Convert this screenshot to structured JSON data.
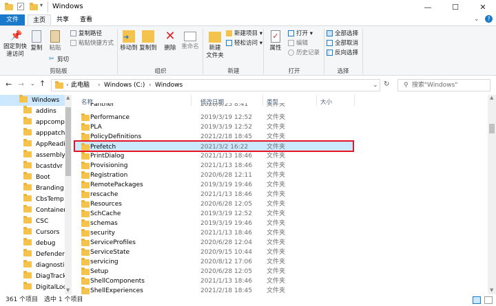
{
  "window": {
    "title": "Windows",
    "minimize": "—",
    "maximize": "☐",
    "close": "✕",
    "help": "?"
  },
  "tabs": [
    {
      "label": "文件"
    },
    {
      "label": "主页"
    },
    {
      "label": "共享"
    },
    {
      "label": "查看"
    }
  ],
  "ribbon": {
    "clipboard": {
      "pin": "固定到快\n速访问",
      "copy": "复制",
      "paste": "粘贴",
      "copy_path": "复制路径",
      "paste_shortcut": "粘贴快捷方式",
      "cut": "剪切",
      "label": "剪贴板"
    },
    "organize": {
      "move_to": "移动到",
      "copy_to": "复制到",
      "delete": "删除",
      "rename": "重命名",
      "label": "组织"
    },
    "new": {
      "new_folder": "新建\n文件夹",
      "new_item": "新建项目",
      "easy_access": "轻松访问",
      "label": "新建"
    },
    "open": {
      "properties": "属性",
      "open": "打开",
      "edit": "编辑",
      "history": "历史记录",
      "label": "打开"
    },
    "select": {
      "select_all": "全部选择",
      "select_none": "全部取消",
      "invert": "反向选择",
      "label": "选择"
    }
  },
  "address": {
    "crumbs": [
      "此电脑",
      "Windows (C:)",
      "Windows"
    ],
    "search_placeholder": "搜索\"Windows\""
  },
  "columns": {
    "name": "名称",
    "date": "修改日期",
    "type": "类型",
    "size": "大小"
  },
  "nav": [
    "Windows",
    "addins",
    "appcompat",
    "apppatch",
    "AppReadine",
    "assembly",
    "bcastdvr",
    "Boot",
    "Branding",
    "CbsTemp",
    "Containers",
    "CSC",
    "Cursors",
    "debug",
    "Defender",
    "diagnostics",
    "DiagTrack",
    "DigitalLocke"
  ],
  "files": [
    {
      "name": "Panther",
      "date": "2020/9/25 8:41",
      "type": "文件夹"
    },
    {
      "name": "Performance",
      "date": "2019/3/19 12:52",
      "type": "文件夹"
    },
    {
      "name": "PLA",
      "date": "2019/3/19 12:52",
      "type": "文件夹"
    },
    {
      "name": "PolicyDefinitions",
      "date": "2021/2/18 18:45",
      "type": "文件夹"
    },
    {
      "name": "Prefetch",
      "date": "2021/3/2 16:22",
      "type": "文件夹"
    },
    {
      "name": "PrintDialog",
      "date": "2021/1/13 18:46",
      "type": "文件夹"
    },
    {
      "name": "Provisioning",
      "date": "2021/1/13 18:46",
      "type": "文件夹"
    },
    {
      "name": "Registration",
      "date": "2020/6/28 12:11",
      "type": "文件夹"
    },
    {
      "name": "RemotePackages",
      "date": "2019/3/19 19:46",
      "type": "文件夹"
    },
    {
      "name": "rescache",
      "date": "2021/1/13 18:46",
      "type": "文件夹"
    },
    {
      "name": "Resources",
      "date": "2020/6/28 12:05",
      "type": "文件夹"
    },
    {
      "name": "SchCache",
      "date": "2019/3/19 12:52",
      "type": "文件夹"
    },
    {
      "name": "schemas",
      "date": "2019/3/19 19:46",
      "type": "文件夹"
    },
    {
      "name": "security",
      "date": "2021/1/13 18:46",
      "type": "文件夹"
    },
    {
      "name": "ServiceProfiles",
      "date": "2020/6/28 12:04",
      "type": "文件夹"
    },
    {
      "name": "ServiceState",
      "date": "2020/9/15 10:44",
      "type": "文件夹"
    },
    {
      "name": "servicing",
      "date": "2020/8/12 17:06",
      "type": "文件夹"
    },
    {
      "name": "Setup",
      "date": "2020/6/28 12:05",
      "type": "文件夹"
    },
    {
      "name": "ShellComponents",
      "date": "2021/1/13 18:46",
      "type": "文件夹"
    },
    {
      "name": "ShellExperiences",
      "date": "2021/2/18 18:45",
      "type": "文件夹"
    }
  ],
  "status": {
    "count": "361 个项目",
    "selected": "选中 1 个项目"
  },
  "colors": {
    "accent": "#1979ca",
    "highlight": "#cce8ff",
    "red_box": "#e81123"
  }
}
